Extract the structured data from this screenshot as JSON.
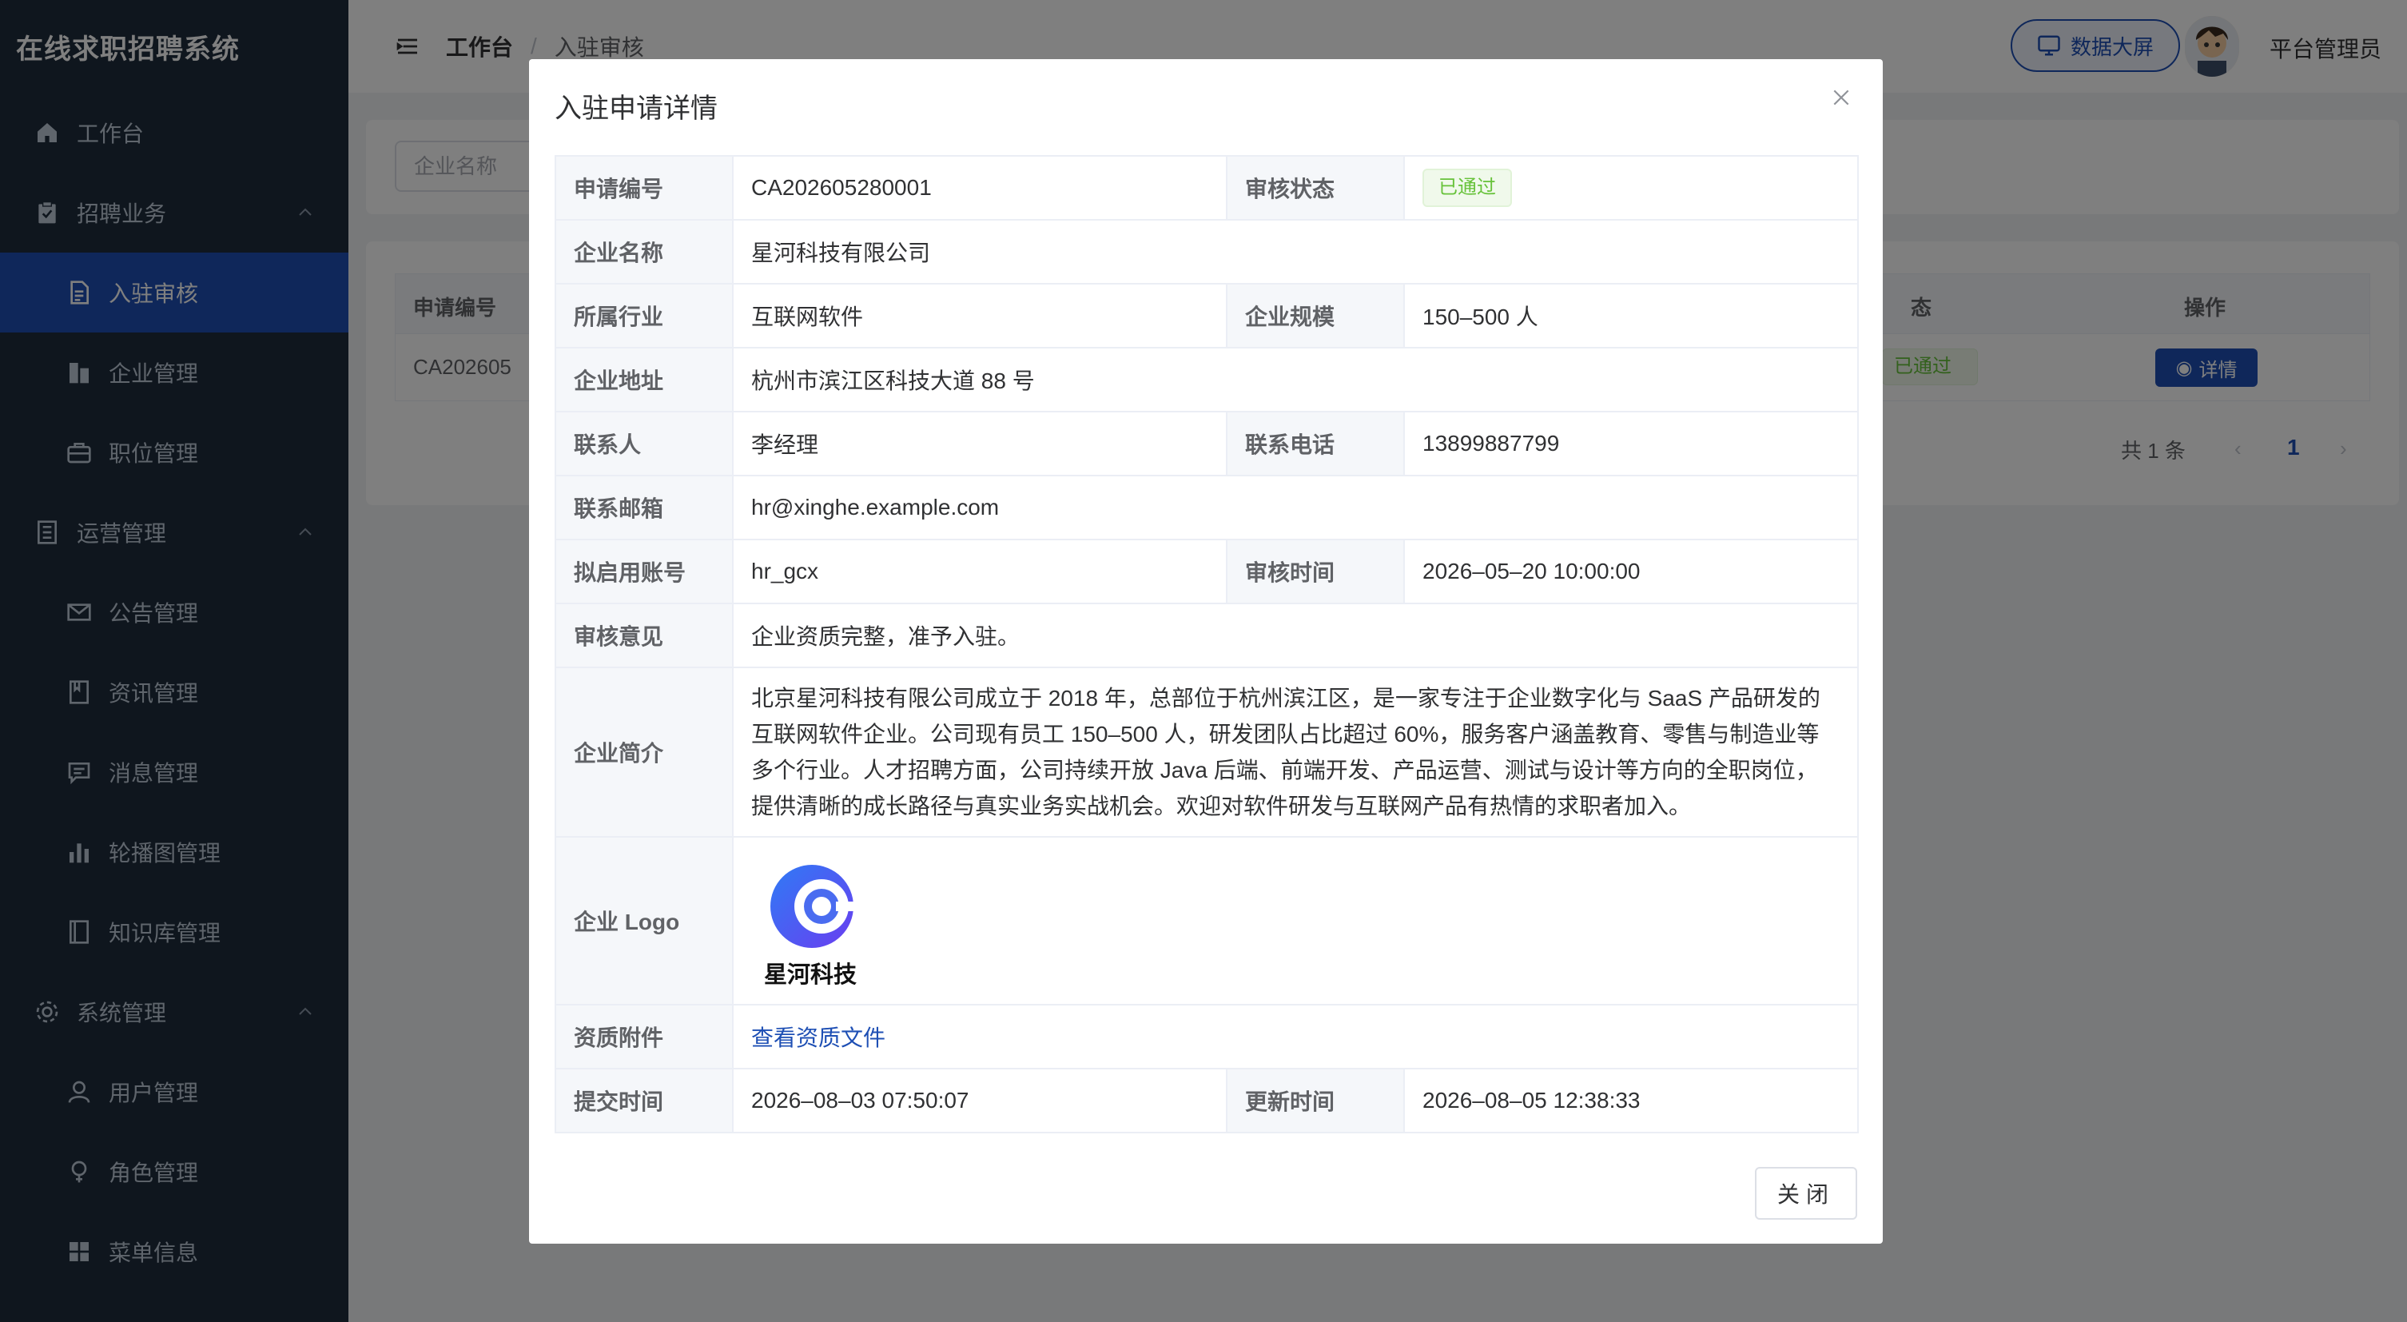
{
  "app": {
    "title": "在线求职招聘系统"
  },
  "sidebar": {
    "items": [
      {
        "label": "工作台",
        "icon": "home-icon"
      },
      {
        "label": "招聘业务",
        "icon": "clipboard-check-icon"
      },
      {
        "label": "入驻审核",
        "icon": "document-icon"
      },
      {
        "label": "企业管理",
        "icon": "building-icon"
      },
      {
        "label": "职位管理",
        "icon": "briefcase-icon"
      },
      {
        "label": "运营管理",
        "icon": "notebook-icon"
      },
      {
        "label": "公告管理",
        "icon": "mail-icon"
      },
      {
        "label": "资讯管理",
        "icon": "news-icon"
      },
      {
        "label": "消息管理",
        "icon": "chat-icon"
      },
      {
        "label": "轮播图管理",
        "icon": "bar-chart-icon"
      },
      {
        "label": "知识库管理",
        "icon": "book-icon"
      },
      {
        "label": "系统管理",
        "icon": "gear-icon"
      },
      {
        "label": "用户管理",
        "icon": "user-icon"
      },
      {
        "label": "角色管理",
        "icon": "lightbulb-icon"
      },
      {
        "label": "菜单信息",
        "icon": "grid-icon"
      }
    ]
  },
  "header": {
    "breadcrumb_home": "工作台",
    "breadcrumb_sep": "/",
    "breadcrumb_current": "入驻审核",
    "screen_button": "数据大屏",
    "admin_name": "平台管理员"
  },
  "search": {
    "company_placeholder": "企业名称"
  },
  "table": {
    "col_app_no": "申请编号",
    "col_status_partial": "态",
    "col_action": "操作",
    "row_app_no_partial": "CA202605",
    "row_status_partial": "已通过",
    "detail_button": "详情"
  },
  "pagination": {
    "total": "共 1 条",
    "prev": "‹",
    "current": "1",
    "next": "›"
  },
  "modal": {
    "title": "入驻申请详情",
    "labels": {
      "app_no": "申请编号",
      "status": "审核状态",
      "company_name": "企业名称",
      "industry": "所属行业",
      "scale": "企业规模",
      "address": "企业地址",
      "contact": "联系人",
      "phone": "联系电话",
      "email": "联系邮箱",
      "account": "拟启用账号",
      "review_time": "审核时间",
      "review_opinion": "审核意见",
      "intro": "企业简介",
      "logo": "企业 Logo",
      "attachment": "资质附件",
      "submit_time": "提交时间",
      "update_time": "更新时间"
    },
    "values": {
      "app_no": "CA202605280001",
      "status": "已通过",
      "company_name": "星河科技有限公司",
      "industry": "互联网软件",
      "scale": "150–500 人",
      "address": "杭州市滨江区科技大道 88 号",
      "contact": "李经理",
      "phone": "13899887799",
      "email": "hr@xinghe.example.com",
      "account": "hr_gcx",
      "review_time": "2026–05–20 10:00:00",
      "review_opinion": "企业资质完整，准予入驻。",
      "intro_line1": "北京星河科技有限公司成立于 2018 年，总部位于杭州滨江区，是一家专注于企业数字化与 SaaS 产品研发的",
      "intro_line2": "互联网软件企业。公司现有员工 150–500 人，研发团队占比超过 60%，服务客户涵盖教育、零售与制造业等",
      "intro_line3": "多个行业。人才招聘方面，公司持续开放 Java 后端、前端开发、产品运营、测试与设计等方向的全职岗位，",
      "intro_line4": "提供清晰的成长路径与真实业务实战机会。欢迎对软件研发与互联网产品有热情的求职者加入。",
      "logo_text": "星河科技",
      "attachment_link": "查看资质文件",
      "submit_time": "2026–08–03 07:50:07",
      "update_time": "2026–08–05 12:38:33"
    },
    "close_button": "关闭"
  },
  "colors": {
    "primary": "#1e4fb4",
    "sidebar_bg": "#1f2d3d",
    "success": "#67c23a"
  }
}
